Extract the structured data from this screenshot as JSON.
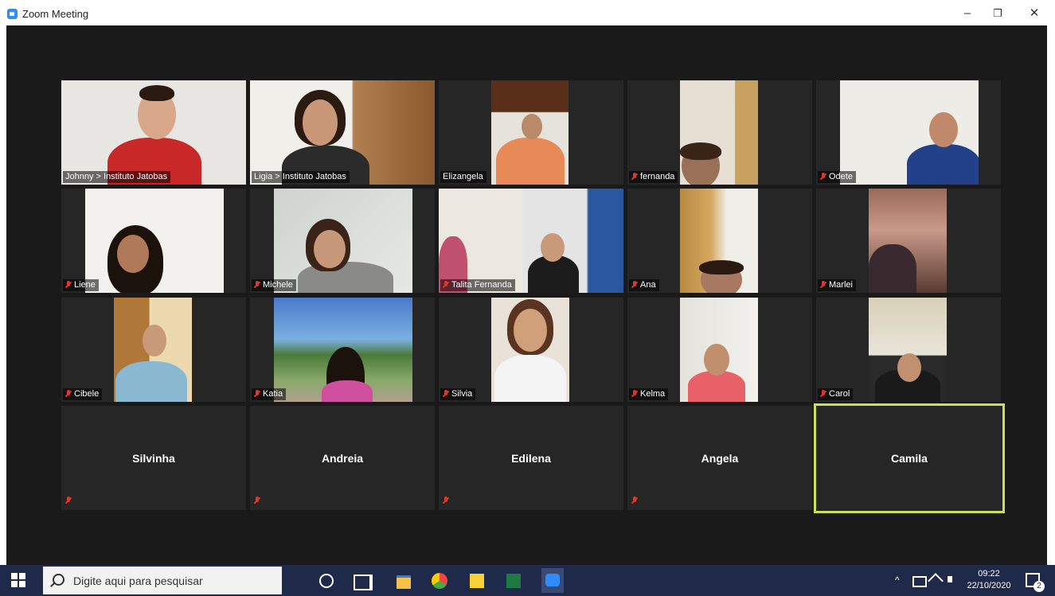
{
  "window": {
    "title": "Zoom Meeting",
    "controls": {
      "minimize": "–",
      "maximize": "❐",
      "close": "✕"
    }
  },
  "participants": [
    {
      "name": "Johnny > Instituto Jatobas",
      "video": true,
      "muted": false
    },
    {
      "name": "Ligia > Instituto Jatobas",
      "video": true,
      "muted": false
    },
    {
      "name": "Elizangela",
      "video": true,
      "muted": false
    },
    {
      "name": "fernanda",
      "video": true,
      "muted": true
    },
    {
      "name": "Odete",
      "video": true,
      "muted": true
    },
    {
      "name": "Liene",
      "video": true,
      "muted": true
    },
    {
      "name": "Michele",
      "video": true,
      "muted": true
    },
    {
      "name": "Talita Fernanda",
      "video": true,
      "muted": true
    },
    {
      "name": "Ana",
      "video": true,
      "muted": true
    },
    {
      "name": "Marlei",
      "video": true,
      "muted": true
    },
    {
      "name": "Cibele",
      "video": true,
      "muted": true
    },
    {
      "name": "Katia",
      "video": true,
      "muted": true
    },
    {
      "name": "Silvia",
      "video": true,
      "muted": true
    },
    {
      "name": "Kelma",
      "video": true,
      "muted": true
    },
    {
      "name": "Carol",
      "video": true,
      "muted": true
    },
    {
      "name": "Silvinha",
      "video": false,
      "muted": true
    },
    {
      "name": "Andreia",
      "video": false,
      "muted": true
    },
    {
      "name": "Edilena",
      "video": false,
      "muted": true
    },
    {
      "name": "Angela",
      "video": false,
      "muted": true
    },
    {
      "name": "Camila",
      "video": false,
      "muted": false,
      "active_speaker": true
    }
  ],
  "taskbar": {
    "search_placeholder": "Digite aqui para pesquisar",
    "apps": [
      "cortana-icon",
      "task-view-icon",
      "file-explorer-icon",
      "chrome-icon",
      "sticky-notes-icon",
      "excel-icon",
      "zoom-icon"
    ],
    "tray": {
      "chevron": "^",
      "time": "09:22",
      "date": "22/10/2020",
      "notifications": "2"
    }
  },
  "colors": {
    "speaker_border": "#c8e05a",
    "muted_mic": "#e0362b",
    "zoom_blue": "#2d8cff",
    "taskbar": "#1f2a4a"
  }
}
